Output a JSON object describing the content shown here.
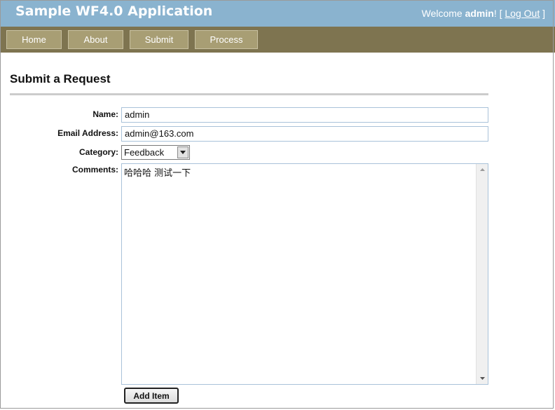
{
  "header": {
    "title": "Sample WF4.0 Application",
    "welcome_prefix": "Welcome",
    "username": "admin",
    "bracket_text": "! [",
    "logout_label": "Log Out",
    "bracket_close": "]"
  },
  "nav": {
    "items": [
      {
        "label": "Home"
      },
      {
        "label": "About"
      },
      {
        "label": "Submit"
      },
      {
        "label": "Process"
      }
    ]
  },
  "page": {
    "title": "Submit a Request"
  },
  "form": {
    "name_label": "Name:",
    "name_value": "admin",
    "email_label": "Email Address:",
    "email_value": "admin@163.com",
    "category_label": "Category:",
    "category_value": "Feedback",
    "comments_label": "Comments:",
    "comments_value": "哈哈哈 测试一下",
    "submit_label": "Add Item"
  },
  "colors": {
    "header_bg": "#8ab3cf",
    "nav_bg": "#7e7450",
    "nav_button_bg": "#a89e74"
  }
}
